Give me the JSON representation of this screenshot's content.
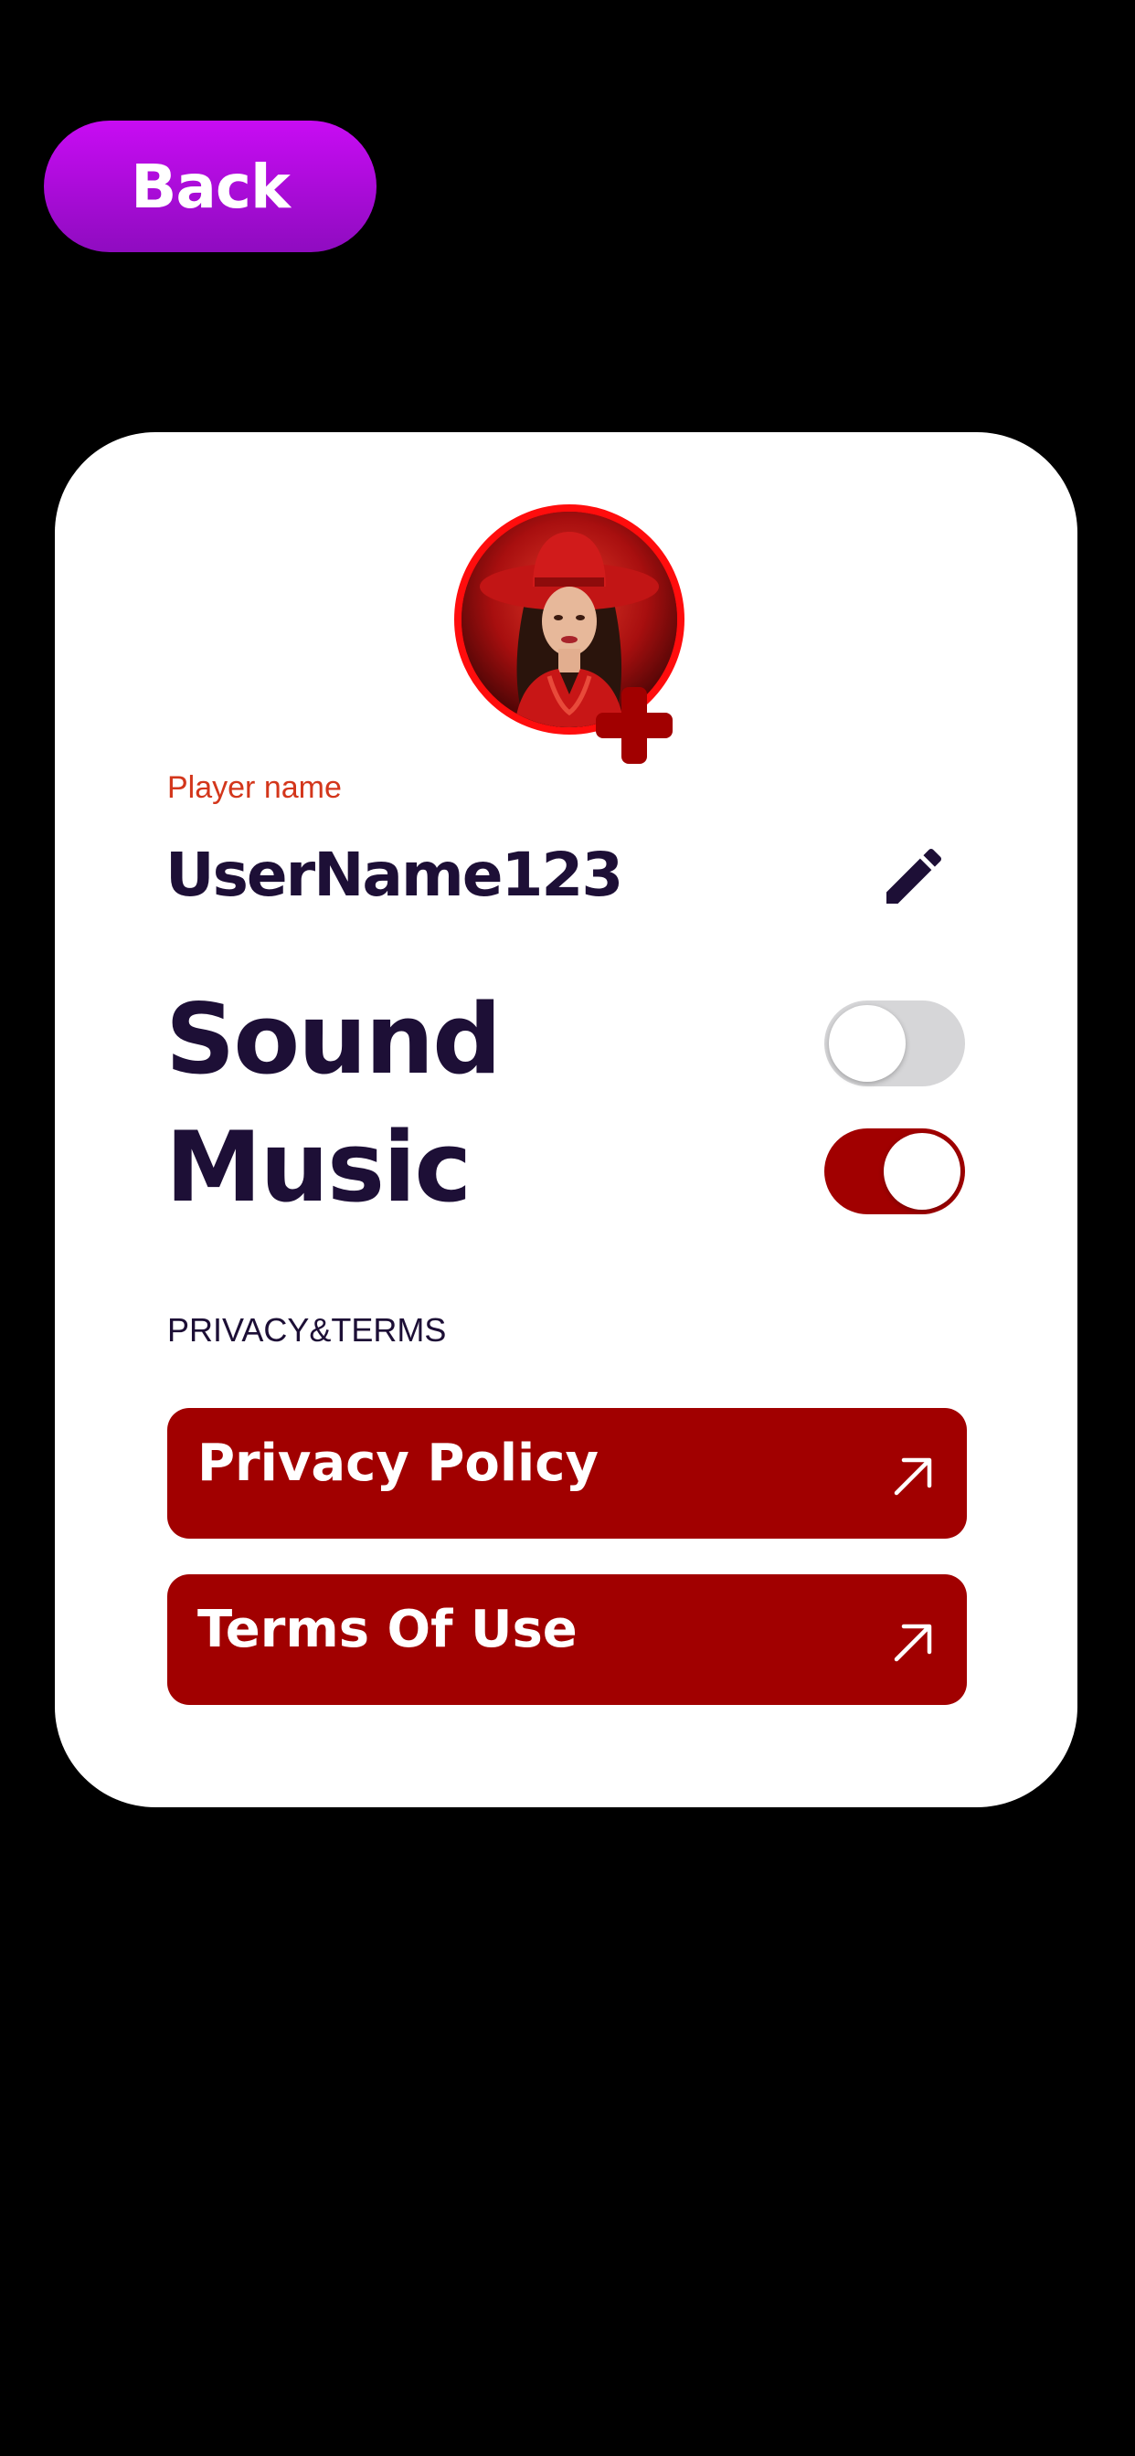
{
  "header": {
    "back_label": "Back"
  },
  "profile": {
    "player_name_label": "Player name",
    "username": "UserName123",
    "avatar_icon": "avatar-icon",
    "add_icon": "add-icon",
    "edit_icon": "pencil-icon"
  },
  "settings": {
    "sound_label": "Sound",
    "sound_enabled": false,
    "music_label": "Music",
    "music_enabled": true
  },
  "privacy": {
    "heading": "PRIVACY&TERMS",
    "links": [
      {
        "label": "Privacy Policy",
        "icon": "arrow-up-right-icon"
      },
      {
        "label": "Terms Of Use",
        "icon": "arrow-up-right-icon"
      }
    ]
  },
  "colors": {
    "background": "#000000",
    "card": "#ffffff",
    "back_button_top": "#c80cf3",
    "back_button_bottom": "#8f0cc0",
    "accent_red": "#a10000",
    "avatar_ring": "#ff0d0d",
    "label_red": "#d3361b",
    "text_dark": "#1d0f36",
    "toggle_off": "#d6d6d8"
  }
}
